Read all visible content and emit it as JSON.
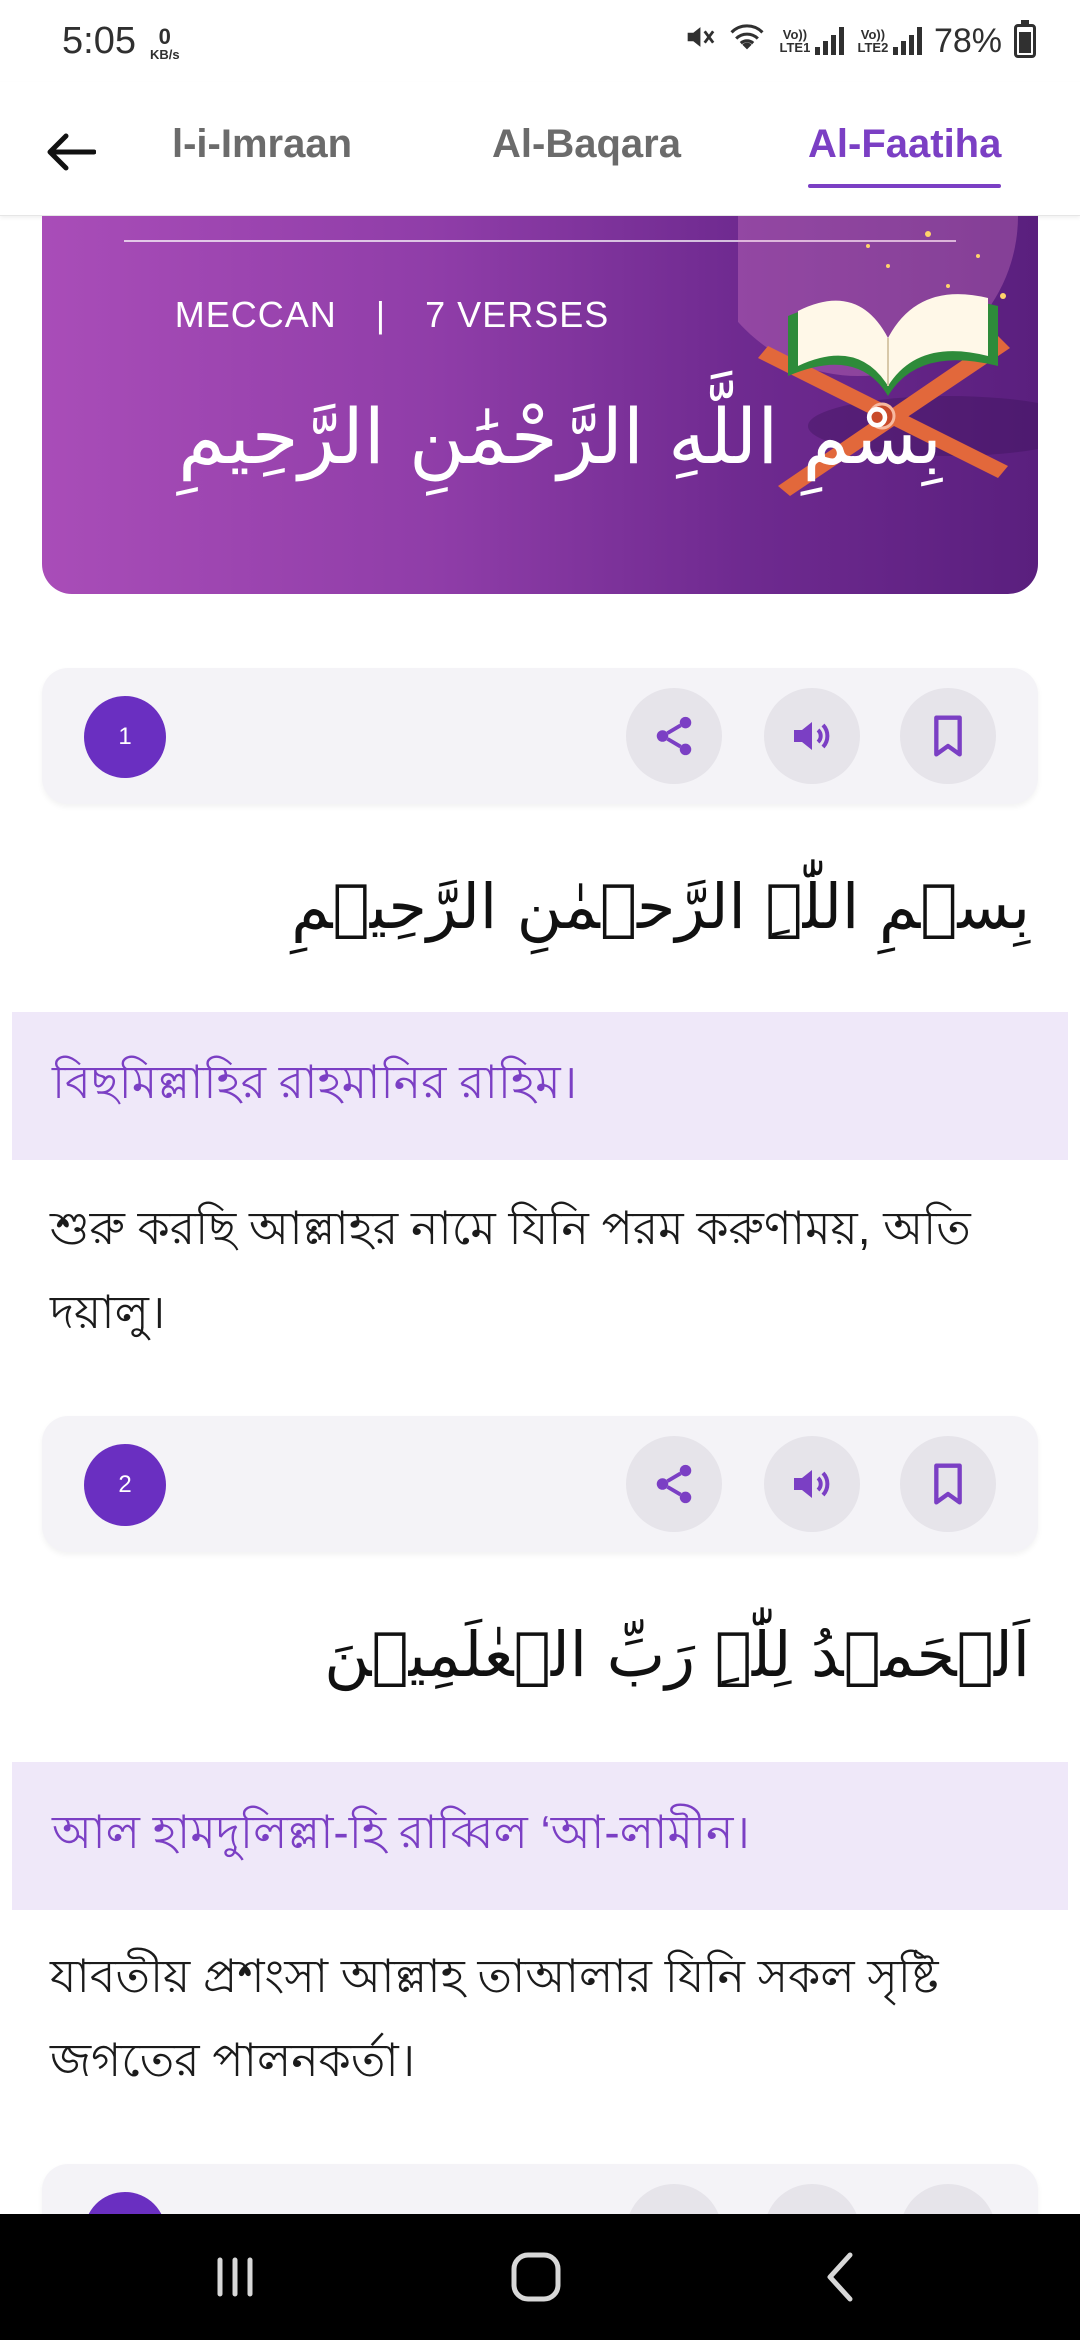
{
  "status_bar": {
    "time": "5:05",
    "net_speed_value": "0",
    "net_speed_unit": "KB/s",
    "sim1_label": "Vo)) LTE1",
    "sim2_label": "Vo)) LTE2",
    "battery": "78%"
  },
  "tabs": [
    {
      "label": "l-i-Imraan",
      "selected": false
    },
    {
      "label": "Al-Baqara",
      "selected": false
    },
    {
      "label": "Al-Faatiha",
      "selected": true
    }
  ],
  "header": {
    "revelation": "MECCAN",
    "separator": "|",
    "verse_count": "7  VERSES",
    "bismillah": "بِسْمِ اللَّهِ الرَّحْمَٰنِ الرَّحِيمِ"
  },
  "verses": [
    {
      "number": "1",
      "arabic": "بِسۡمِ اللّٰہِ الرَّحۡمٰنِ الرَّحِیۡمِ",
      "transliteration": "বিছমিল্লাহির রাহমানির রাহিম।",
      "translation": "শুরু করছি আল্লাহর নামে যিনি পরম করুণাময়, অতি দয়ালু।"
    },
    {
      "number": "2",
      "arabic": "اَلۡحَمۡدُ لِلّٰہِ رَبِّ الۡعٰلَمِیۡنَ",
      "transliteration": "আল হামদুলিল্লা-হি রাব্বিল ‘আ-লামীন।",
      "translation": "যাবতীয় প্রশংসা আল্লাহ তাআলার যিনি সকল সৃষ্টি জগতের পালনকর্তা।"
    }
  ],
  "colors": {
    "accent": "#7b3fc4",
    "verse_badge": "#6a2fc1",
    "translit_bg": "#efe8f9",
    "toolbar_bg": "#f4f3f7",
    "action_bg": "#e6e4ea"
  },
  "icons": {
    "back": "arrow-left-icon",
    "share": "share-icon",
    "audio": "speaker-icon",
    "bookmark": "bookmark-icon",
    "nav_recents": "recents-icon",
    "nav_home": "home-icon",
    "nav_back": "back-chevron-icon"
  }
}
